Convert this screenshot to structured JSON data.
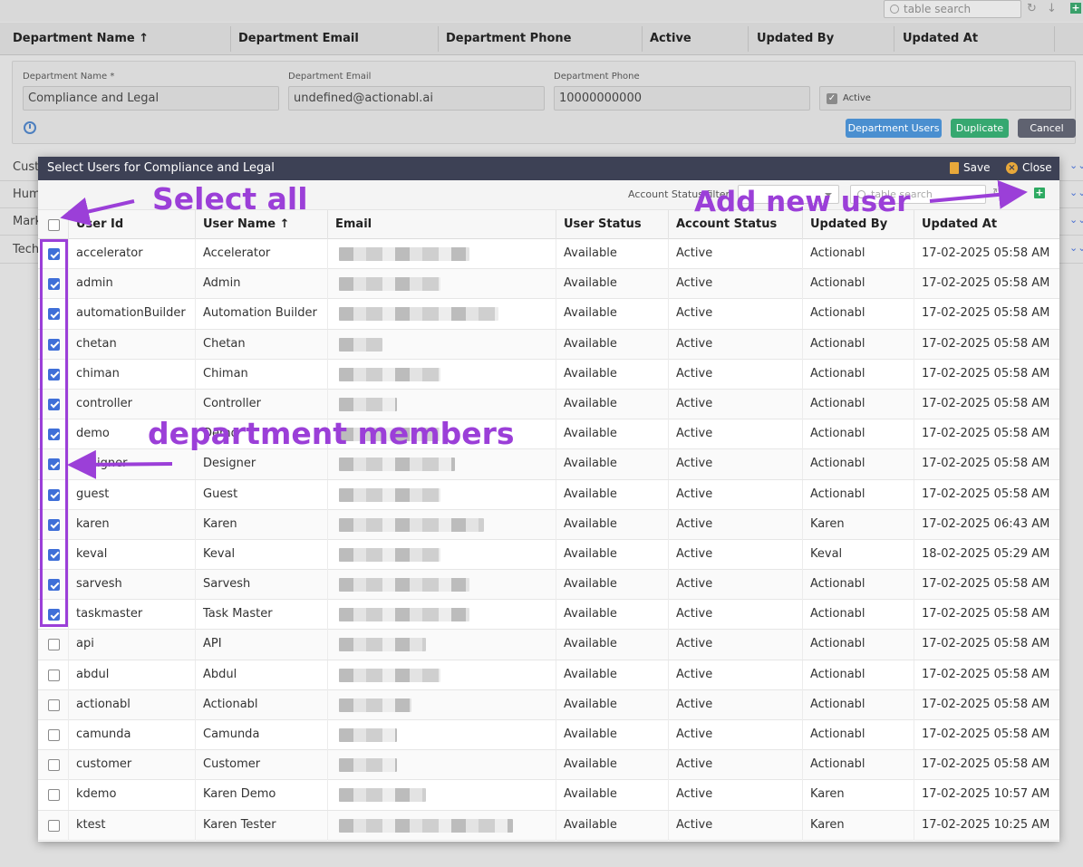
{
  "background": {
    "search_placeholder": "table search",
    "columns": [
      "Department Name",
      "Department Email",
      "Department Phone",
      "Active",
      "Updated By",
      "Updated At"
    ],
    "form": {
      "name_label": "Department Name *",
      "name_value": "Compliance and Legal",
      "email_label": "Department Email",
      "email_value": "undefined@actionabl.ai",
      "phone_label": "Department Phone",
      "phone_value": "10000000000",
      "active_label": "Active",
      "buttons": {
        "department_users": "Department Users",
        "duplicate": "Duplicate",
        "cancel": "Cancel"
      }
    },
    "rows": [
      "Cust",
      "Hum",
      "Mark",
      "Tech"
    ]
  },
  "modal": {
    "title": "Select Users for Compliance and Legal",
    "save_label": "Save",
    "close_label": "Close",
    "filter_label": "Account Status filter",
    "search_placeholder": "table search",
    "columns": [
      "User Id",
      "User Name",
      "Email",
      "User Status",
      "Account Status",
      "Updated By",
      "Updated At"
    ],
    "rows": [
      {
        "checked": true,
        "id": "accelerator",
        "name": "Accelerator",
        "status": "Available",
        "account": "Active",
        "by": "Actionabl",
        "at": "17-02-2025 05:58 AM",
        "blur": 144
      },
      {
        "checked": true,
        "id": "admin",
        "name": "Admin",
        "status": "Available",
        "account": "Active",
        "by": "Actionabl",
        "at": "17-02-2025 05:58 AM",
        "blur": 112
      },
      {
        "checked": true,
        "id": "automationBuilder",
        "name": "Automation Builder",
        "status": "Available",
        "account": "Active",
        "by": "Actionabl",
        "at": "17-02-2025 05:58 AM",
        "blur": 176
      },
      {
        "checked": true,
        "id": "chetan",
        "name": "Chetan",
        "status": "Available",
        "account": "Active",
        "by": "Actionabl",
        "at": "17-02-2025 05:58 AM",
        "blur": 48
      },
      {
        "checked": true,
        "id": "chiman",
        "name": "Chiman",
        "status": "Available",
        "account": "Active",
        "by": "Actionabl",
        "at": "17-02-2025 05:58 AM",
        "blur": 112
      },
      {
        "checked": true,
        "id": "controller",
        "name": "Controller",
        "status": "Available",
        "account": "Active",
        "by": "Actionabl",
        "at": "17-02-2025 05:58 AM",
        "blur": 64
      },
      {
        "checked": true,
        "id": "demo",
        "name": "Demo",
        "status": "Available",
        "account": "Active",
        "by": "Actionabl",
        "at": "17-02-2025 05:58 AM",
        "blur": 112
      },
      {
        "checked": true,
        "id": "designer",
        "name": "Designer",
        "status": "Available",
        "account": "Active",
        "by": "Actionabl",
        "at": "17-02-2025 05:58 AM",
        "blur": 128
      },
      {
        "checked": true,
        "id": "guest",
        "name": "Guest",
        "status": "Available",
        "account": "Active",
        "by": "Actionabl",
        "at": "17-02-2025 05:58 AM",
        "blur": 112
      },
      {
        "checked": true,
        "id": "karen",
        "name": "Karen",
        "status": "Available",
        "account": "Active",
        "by": "Karen",
        "at": "17-02-2025 06:43 AM",
        "blur": 160
      },
      {
        "checked": true,
        "id": "keval",
        "name": "Keval",
        "status": "Available",
        "account": "Active",
        "by": "Keval",
        "at": "18-02-2025 05:29 AM",
        "blur": 112
      },
      {
        "checked": true,
        "id": "sarvesh",
        "name": "Sarvesh",
        "status": "Available",
        "account": "Active",
        "by": "Actionabl",
        "at": "17-02-2025 05:58 AM",
        "blur": 144
      },
      {
        "checked": true,
        "id": "taskmaster",
        "name": "Task Master",
        "status": "Available",
        "account": "Active",
        "by": "Actionabl",
        "at": "17-02-2025 05:58 AM",
        "blur": 144
      },
      {
        "checked": false,
        "id": "api",
        "name": "API",
        "status": "Available",
        "account": "Active",
        "by": "Actionabl",
        "at": "17-02-2025 05:58 AM",
        "blur": 96
      },
      {
        "checked": false,
        "id": "abdul",
        "name": "Abdul",
        "status": "Available",
        "account": "Active",
        "by": "Actionabl",
        "at": "17-02-2025 05:58 AM",
        "blur": 112
      },
      {
        "checked": false,
        "id": "actionabl",
        "name": "Actionabl",
        "status": "Available",
        "account": "Active",
        "by": "Actionabl",
        "at": "17-02-2025 05:58 AM",
        "blur": 80
      },
      {
        "checked": false,
        "id": "camunda",
        "name": "Camunda",
        "status": "Available",
        "account": "Active",
        "by": "Actionabl",
        "at": "17-02-2025 05:58 AM",
        "blur": 64
      },
      {
        "checked": false,
        "id": "customer",
        "name": "Customer",
        "status": "Available",
        "account": "Active",
        "by": "Actionabl",
        "at": "17-02-2025 05:58 AM",
        "blur": 64
      },
      {
        "checked": false,
        "id": "kdemo",
        "name": "Karen Demo",
        "status": "Available",
        "account": "Active",
        "by": "Karen",
        "at": "17-02-2025 10:57 AM",
        "blur": 96
      },
      {
        "checked": false,
        "id": "ktest",
        "name": "Karen Tester",
        "status": "Available",
        "account": "Active",
        "by": "Karen",
        "at": "17-02-2025 10:25 AM",
        "blur": 192
      }
    ]
  },
  "annotations": {
    "select_all": "Select all",
    "add_new_user": "Add new user",
    "department_members": "department members"
  },
  "colors": {
    "annotation": "#9b3fd8",
    "checkbox": "#3f6fd8",
    "title_bar": "#3d4155",
    "save_icon": "#e8a83a",
    "add_icon": "#2eaa62"
  }
}
